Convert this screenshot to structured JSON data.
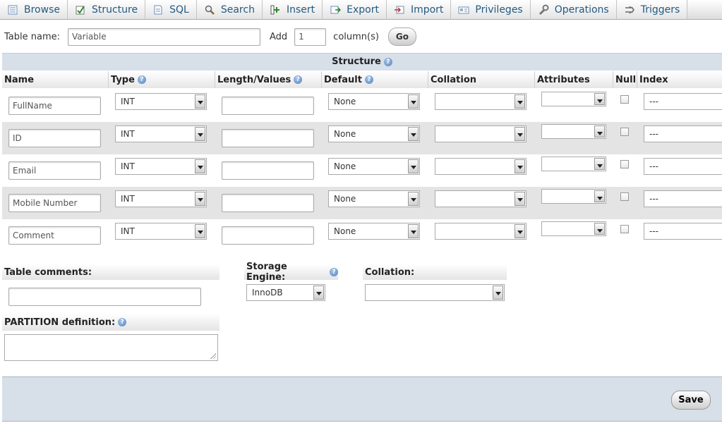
{
  "tabs": [
    {
      "label": "Browse",
      "icon": "browse-icon"
    },
    {
      "label": "Structure",
      "icon": "structure-icon"
    },
    {
      "label": "SQL",
      "icon": "sql-icon"
    },
    {
      "label": "Search",
      "icon": "search-icon"
    },
    {
      "label": "Insert",
      "icon": "insert-icon"
    },
    {
      "label": "Export",
      "icon": "export-icon"
    },
    {
      "label": "Import",
      "icon": "import-icon"
    },
    {
      "label": "Privileges",
      "icon": "privileges-icon"
    },
    {
      "label": "Operations",
      "icon": "operations-icon"
    },
    {
      "label": "Triggers",
      "icon": "triggers-icon"
    }
  ],
  "table_name": {
    "label": "Table name:",
    "value": "Variable"
  },
  "add_columns": {
    "label": "Add",
    "value": "1",
    "suffix": "column(s)",
    "go": "Go"
  },
  "structure": {
    "title": "Structure",
    "headers": {
      "name": "Name",
      "type": "Type",
      "length": "Length/Values",
      "default": "Default",
      "collation": "Collation",
      "attributes": "Attributes",
      "null": "Null",
      "index": "Index"
    },
    "rows": [
      {
        "name": "FullName",
        "type": "INT",
        "length": "",
        "default": "None",
        "collation": "",
        "attributes": "",
        "null": false,
        "index": "---"
      },
      {
        "name": "ID",
        "type": "INT",
        "length": "",
        "default": "None",
        "collation": "",
        "attributes": "",
        "null": false,
        "index": "---"
      },
      {
        "name": "Email",
        "type": "INT",
        "length": "",
        "default": "None",
        "collation": "",
        "attributes": "",
        "null": false,
        "index": "---"
      },
      {
        "name": "Mobile Number",
        "type": "INT",
        "length": "",
        "default": "None",
        "collation": "",
        "attributes": "",
        "null": false,
        "index": "---"
      },
      {
        "name": "Comment",
        "type": "INT",
        "length": "",
        "default": "None",
        "collation": "",
        "attributes": "",
        "null": false,
        "index": "---"
      }
    ]
  },
  "options": {
    "table_comments": "Table comments:",
    "storage_engine": "Storage Engine:",
    "storage_engine_value": "InnoDB",
    "collation": "Collation:",
    "partition": "PARTITION definition:"
  },
  "footer": {
    "save": "Save"
  },
  "colors": {
    "link": "#235a81",
    "header_bg": "#d7dfe9",
    "row_alt": "#e4e4e4"
  }
}
